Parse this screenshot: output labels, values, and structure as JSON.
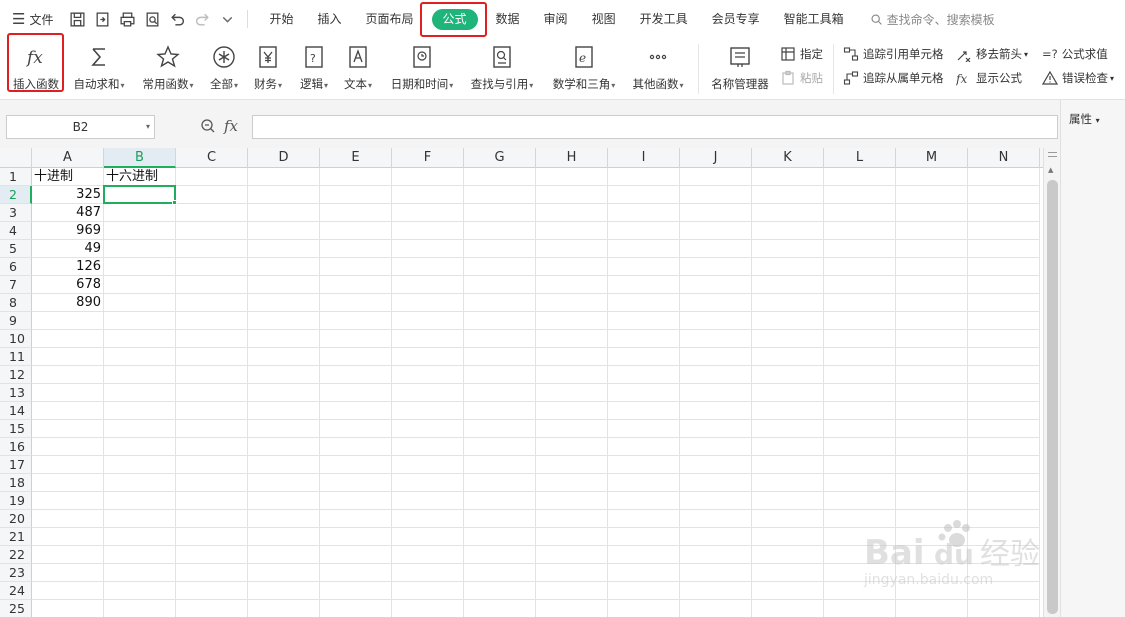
{
  "topbar": {
    "file_label": "文件",
    "tabs": [
      "开始",
      "插入",
      "页面布局",
      "公式",
      "数据",
      "审阅",
      "视图",
      "开发工具",
      "会员专享",
      "智能工具箱"
    ],
    "active_tab": "公式",
    "search_placeholder": "查找命令、搜索模板"
  },
  "ribbon": {
    "insert_function": "插入函数",
    "autosum": "自动求和",
    "common_functions": "常用函数",
    "all": "全部",
    "finance": "财务",
    "logic": "逻辑",
    "text": "文本",
    "datetime": "日期和时间",
    "lookup": "查找与引用",
    "math": "数学和三角",
    "other": "其他函数",
    "name_manager": "名称管理器",
    "specify": "指定",
    "paste": "粘贴",
    "trace_precedents": "追踪引用单元格",
    "trace_dependents": "追踪从属单元格",
    "remove_arrows": "移去箭头",
    "show_formulas": "显示公式",
    "evaluate_formula": "公式求值",
    "error_check": "错误检查",
    "evaluate_prefix": "=?"
  },
  "formula_bar": {
    "name_box": "B2",
    "fx_label": "fx",
    "formula": ""
  },
  "properties_panel": {
    "label": "属性"
  },
  "sheet": {
    "columns": [
      "A",
      "B",
      "C",
      "D",
      "E",
      "F",
      "G",
      "H",
      "I",
      "J",
      "K",
      "L",
      "M",
      "N"
    ],
    "rows": [
      "1",
      "2",
      "3",
      "4",
      "5",
      "6",
      "7",
      "8",
      "9",
      "10",
      "11",
      "12",
      "13",
      "14",
      "15",
      "16",
      "17",
      "18",
      "19",
      "20",
      "21",
      "22",
      "23",
      "24",
      "25"
    ],
    "selected_column": "B",
    "selected_row": "2",
    "cells": {
      "A1": "十进制",
      "B1": "十六进制",
      "A2": "325",
      "A3": "487",
      "A4": "969",
      "A5": "49",
      "A6": "126",
      "A7": "678",
      "A8": "890"
    }
  },
  "watermark": {
    "brand": "Baidu经验",
    "url": "jingyan.baidu.com"
  },
  "colors": {
    "accent_green": "#1fb57a",
    "highlight_red": "#e02020",
    "selection_green": "#1fae5e"
  }
}
